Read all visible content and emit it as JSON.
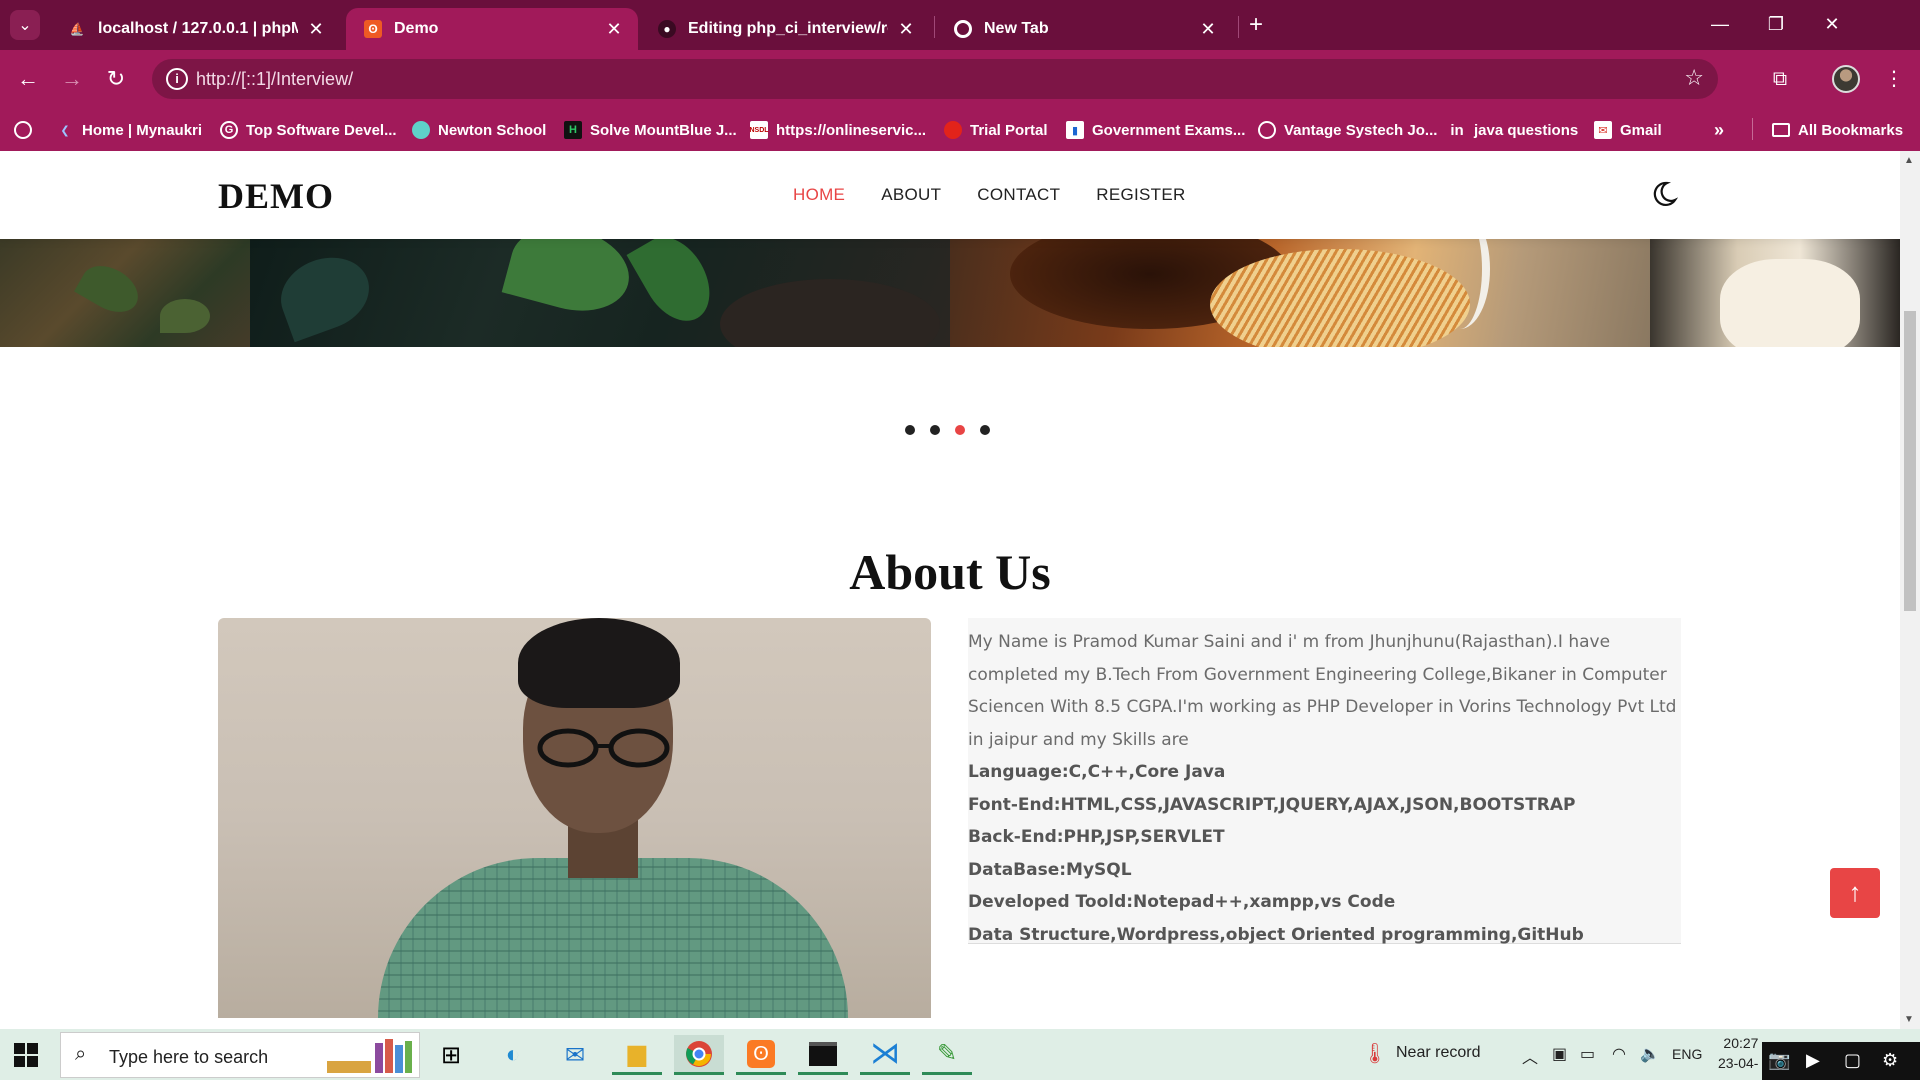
{
  "browser": {
    "tabs": [
      {
        "title": "localhost / 127.0.0.1 | phpMyAdmin",
        "active": false
      },
      {
        "title": "Demo",
        "active": true
      },
      {
        "title": "Editing php_ci_interview/readme",
        "active": false
      },
      {
        "title": "New Tab",
        "active": false
      }
    ],
    "url": "http://[::1]/Interview/",
    "bookmarks": [
      {
        "label": "Home | Mynaukri"
      },
      {
        "label": "Top Software Devel..."
      },
      {
        "label": "Newton School"
      },
      {
        "label": "Solve MountBlue J..."
      },
      {
        "label": "https://onlineservic..."
      },
      {
        "label": "Trial Portal"
      },
      {
        "label": "Government Exams..."
      },
      {
        "label": "Vantage Systech Jo..."
      },
      {
        "label": "java questions"
      },
      {
        "label": "Gmail"
      }
    ],
    "all_bookmarks": "All Bookmarks",
    "colors": {
      "tabstrip": "#6a0f3c",
      "toolbar": "#a11a5a"
    }
  },
  "site": {
    "logo": "DEMO",
    "nav": [
      {
        "label": "HOME",
        "active": true
      },
      {
        "label": "ABOUT",
        "active": false
      },
      {
        "label": "CONTACT",
        "active": false
      },
      {
        "label": "REGISTER",
        "active": false
      }
    ],
    "theme_toggle_icon": "moon-icon",
    "slider": {
      "slide_count": 4,
      "active_index": 2
    },
    "about": {
      "title": "About Us",
      "intro": "My Name is Pramod Kumar Saini and i' m from Jhunjhunu(Rajasthan).I have completed my B.Tech From Government Engineering College,Bikaner in Computer Sciencen With 8.5 CGPA.I'm working as PHP Developer in Vorins Technology Pvt Ltd in jaipur and my Skills are",
      "skills": [
        "Language:C,C++,Core Java",
        "Font-End:HTML,CSS,JAVASCRIPT,JQUERY,AJAX,JSON,BOOTSTRAP",
        "Back-End:PHP,JSP,SERVLET",
        "DataBase:MySQL",
        "Developed Toold:Notepad++,xampp,vs Code",
        "Data Structure,Wordpress,object Oriented programming,GitHub"
      ]
    },
    "back_to_top_icon": "arrow-up-icon",
    "accent_color": "#e84545"
  },
  "taskbar": {
    "search_placeholder": "Type here to search",
    "weather": "Near record",
    "language": "ENG",
    "time": "20:27",
    "date": "23-04-"
  }
}
